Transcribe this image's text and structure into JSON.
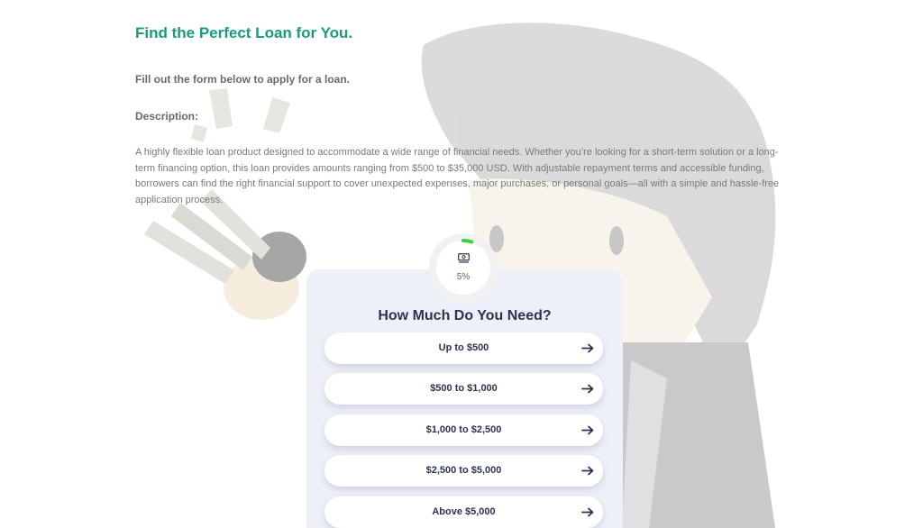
{
  "header": {
    "title": "Find the Perfect Loan for You.",
    "subtitle": "Fill out the form below to apply for a loan.",
    "description_heading": "Description:",
    "description": "A highly flexible loan product designed to accommodate a wide range of financial needs. Whether you’re looking for a short-term solution or a long-term financing option, this loan provides amounts ranging from $500 to $35,000 USD. With adjustable repayment terms and accessible funding, borrowers can find the right financial support to cover unexpected expenses, major purchases, or personal goals—all with a simple and hassle-free application process."
  },
  "progress": {
    "icon": "money-icon",
    "value": 0.05,
    "label": "5%"
  },
  "form": {
    "question": "How Much Do You Need?",
    "options": [
      {
        "label": "Up to $500",
        "icon": "arrow-right-icon"
      },
      {
        "label": "$500 to $1,000",
        "icon": "arrow-right-icon"
      },
      {
        "label": "$1,000 to $2,500",
        "icon": "arrow-right-icon"
      },
      {
        "label": "$2,500 to $5,000",
        "icon": "arrow-right-icon"
      },
      {
        "label": "Above $5,000",
        "icon": "arrow-right-icon"
      }
    ]
  },
  "colors": {
    "title": "#1a9b7c",
    "card_background": "#eef0f8",
    "text_dark": "#2c3353",
    "progress_accent": "#3ecf3e"
  }
}
